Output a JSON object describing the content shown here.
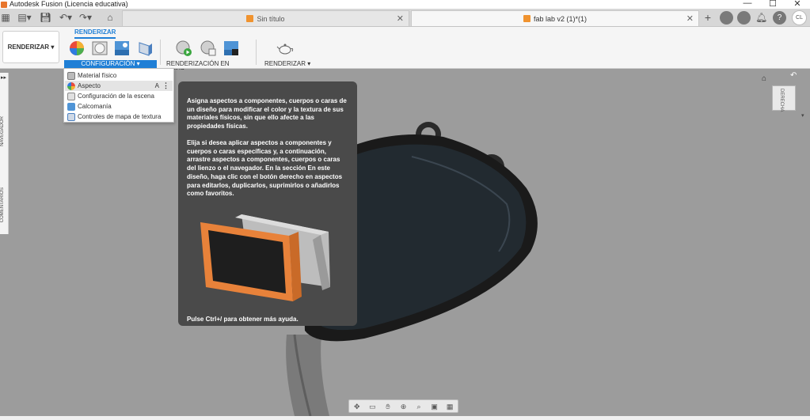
{
  "window": {
    "title": "Autodesk Fusion (Licencia educativa)",
    "minimize": "—",
    "maximize": "☐",
    "close": "✕"
  },
  "tabs": [
    {
      "label": "Sin título",
      "active": false
    },
    {
      "label": "fab lab v2 (1)*(1)",
      "active": true
    }
  ],
  "user": {
    "initials": "CL"
  },
  "ribbon": {
    "workspace": "RENDERIZAR",
    "active_tab": "RENDERIZAR",
    "groups": {
      "configuracion": "CONFIGURACIÓN",
      "renderizacion_lienzo": "RENDERIZACIÓN EN LIENZ...",
      "renderizar": "RENDERIZAR"
    }
  },
  "dropdown": {
    "items": [
      {
        "label": "Material físico",
        "shortcut": ""
      },
      {
        "label": "Aspecto",
        "shortcut": "A"
      },
      {
        "label": "Configuración de la escena",
        "shortcut": ""
      },
      {
        "label": "Calcomanía",
        "shortcut": ""
      },
      {
        "label": "Controles de mapa de textura",
        "shortcut": ""
      }
    ]
  },
  "tooltip": {
    "para1": "Asigna aspectos a componentes, cuerpos o caras de un diseño para modificar el color y la textura de sus materiales físicos, sin que ello afecte a las propiedades físicas.",
    "para2": "Elija si desea aplicar aspectos a componentes y cuerpos o caras específicas y, a continuación, arrastre aspectos a componentes, cuerpos o caras del lienzo o el navegador. En la sección En este diseño, haga clic con el botón derecho en aspectos para editarlos, duplicarlos, suprimirlos o añadirlos como favoritos.",
    "help": "Pulse Ctrl+/ para obtener más ayuda."
  },
  "sidepanel": {
    "navegador": "NAVEGADOR",
    "comentarios": "COMENTARIOS"
  },
  "viewcube": {
    "face": "DERECHA"
  },
  "colors": {
    "accent": "#1f7fd6",
    "tooltip_bg": "#4a4a4a",
    "viewport_bg": "#9c9c9c"
  }
}
